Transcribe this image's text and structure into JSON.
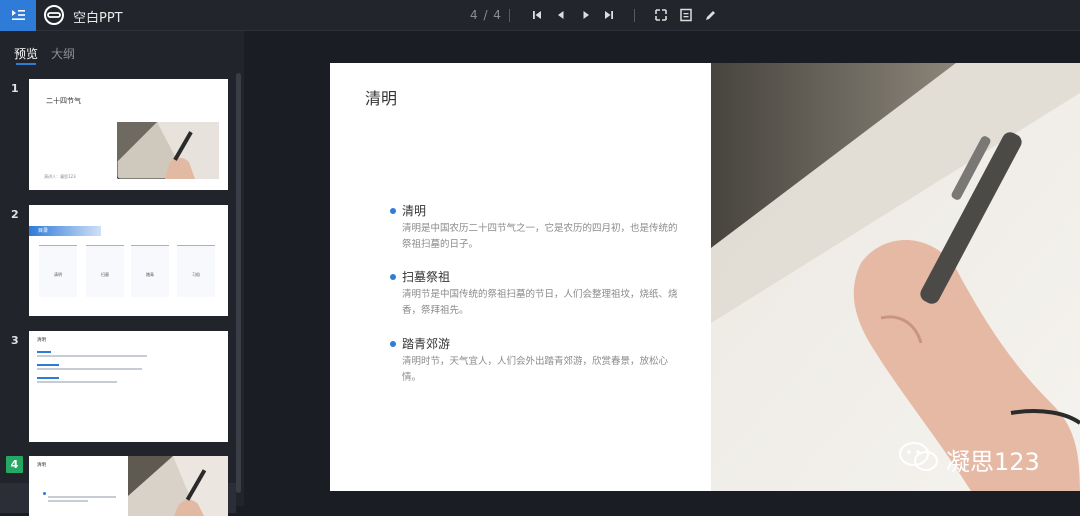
{
  "app": {
    "title": "空白PPT"
  },
  "toolbar": {
    "page_indicator": "4 / 4"
  },
  "sidebar": {
    "tabs": [
      {
        "label": "预览"
      },
      {
        "label": "大纲"
      }
    ],
    "slides": [
      {
        "number": "1",
        "title": "二十四节气",
        "footer": "演讲人：凝思123"
      },
      {
        "number": "2",
        "heading": "目录",
        "items": [
          "清明",
          "扫墓",
          "踏青",
          "习俗"
        ]
      },
      {
        "number": "3",
        "title": "清明"
      },
      {
        "number": "4",
        "title": "清明"
      }
    ]
  },
  "slide": {
    "title": "清明",
    "bullets": [
      {
        "head": "清明",
        "body": "清明是中国农历二十四节气之一，它是农历的四月初，也是传统的祭祖扫墓的日子。"
      },
      {
        "head": "扫墓祭祖",
        "body": "清明节是中国传统的祭祖扫墓的节日，人们会整理祖坟，烧纸、烧香，祭拜祖先。"
      },
      {
        "head": "踏青郊游",
        "body": "清明时节，天气宜人，人们会外出踏青郊游，欣赏春景，放松心情。"
      }
    ]
  },
  "watermark": {
    "text": "凝思123"
  },
  "colors": {
    "accent": "#2f7bd8",
    "active_badge": "#24a864"
  }
}
